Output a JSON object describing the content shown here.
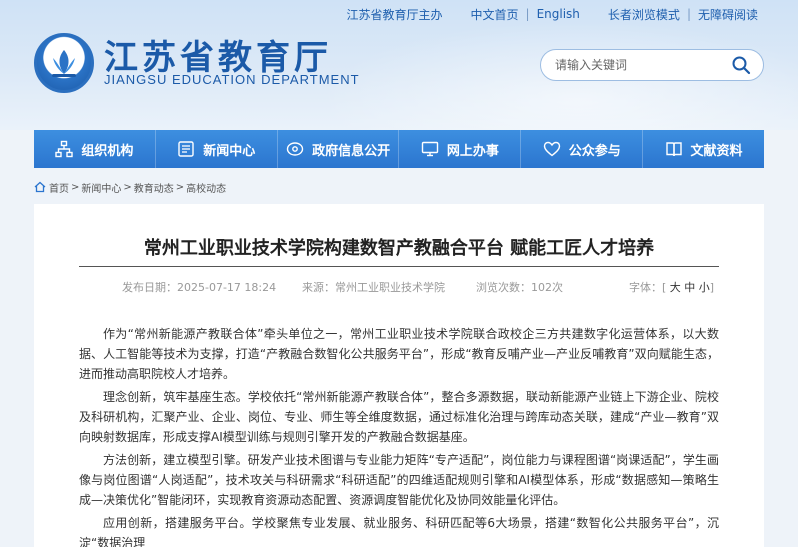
{
  "toplinks": {
    "host": "江苏省教育厅主办",
    "home_cn": "中文首页",
    "english": "English",
    "elderly_mode": "长者浏览模式",
    "accessible": "无障碍阅读"
  },
  "logo": {
    "title": "江苏省教育厅",
    "subtitle": "JIANGSU EDUCATION DEPARTMENT"
  },
  "search": {
    "placeholder": "请输入关键词"
  },
  "nav": [
    {
      "label": "组织机构",
      "icon": "org-chart-icon"
    },
    {
      "label": "新闻中心",
      "icon": "news-icon"
    },
    {
      "label": "政府信息公开",
      "icon": "disclosure-icon"
    },
    {
      "label": "网上办事",
      "icon": "monitor-icon"
    },
    {
      "label": "公众参与",
      "icon": "heart-icon"
    },
    {
      "label": "文献资料",
      "icon": "book-icon"
    }
  ],
  "breadcrumb": [
    "首页",
    "新闻中心",
    "教育动态",
    "高校动态"
  ],
  "article": {
    "title": "常州工业职业技术学院构建数智产教融合平台 赋能工匠人才培养",
    "publish_date": "发布日期：2025-07-17 18:24",
    "source": "来源：常州工业职业技术学院",
    "views": "浏览次数：102次",
    "font_label": "字体：",
    "font_large": "大",
    "font_medium": "中",
    "font_small": "小",
    "paragraphs": [
      "作为“常州新能源产教联合体”牵头单位之一，常州工业职业技术学院联合政校企三方共建数字化运营体系，以大数据、人工智能等技术为支撑，打造“产教融合数智化公共服务平台”，形成“教育反哺产业—产业反哺教育”双向赋能生态，进而推动高职院校人才培养。",
      "理念创新，筑牢基座生态。学校依托“常州新能源产教联合体”，整合多源数据，联动新能源产业链上下游企业、院校及科研机构，汇聚产业、企业、岗位、专业、师生等全维度数据，通过标准化治理与跨库动态关联，建成“产业—教育”双向映射数据库，形成支撑AI模型训练与规则引擎开发的产教融合数据基座。",
      "方法创新，建立模型引擎。研发产业技术图谱与专业能力矩阵“专产适配”，岗位能力与课程图谱“岗课适配”，学生画像与岗位图谱“人岗适配”，技术攻关与科研需求“科研适配”的四维适配规则引擎和AI模型体系，形成“数据感知—策略生成—决策优化”智能闭环，实现教育资源动态配置、资源调度智能优化及协同效能量化评估。",
      "应用创新，搭建服务平台。学校聚焦专业发展、就业服务、科研匹配等6大场景，搭建“数智化公共服务平台”，沉淀“数据治理"
    ]
  },
  "colors": {
    "brand_blue": "#1b5aa8",
    "nav_blue": "#2f7dd6",
    "page_bg": "#eef3f9"
  }
}
